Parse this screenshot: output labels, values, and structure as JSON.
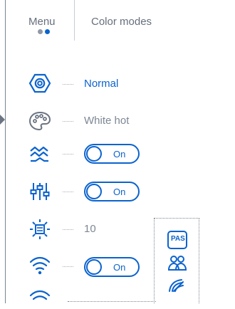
{
  "tabs": {
    "menu_label": "Menu",
    "color_modes_label": "Color modes"
  },
  "settings": {
    "mode_value": "Normal",
    "palette_value": "White hot",
    "wave_toggle_label": "On",
    "sliders_toggle_label": "On",
    "brightness_value": "10",
    "wifi_toggle_label": "On"
  },
  "status": {
    "pas_label": "PAS"
  },
  "colors": {
    "accent": "#0b63ce",
    "text_gray": "#7e8794",
    "icon_gray": "#6b7482"
  },
  "icons": [
    "hex-nut-icon",
    "palette-icon",
    "wave-icon",
    "sliders-icon",
    "brightness-icon",
    "wifi-icon",
    "pas-icon",
    "users-icon",
    "gauge-icon"
  ]
}
